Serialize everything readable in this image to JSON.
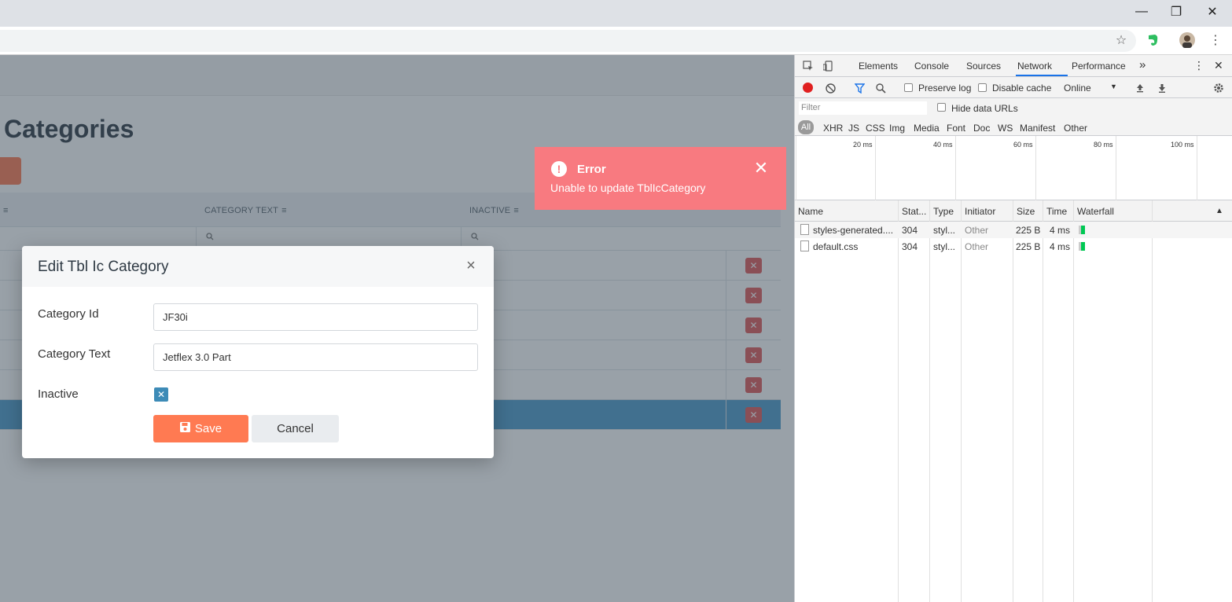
{
  "browser": {
    "window_controls": {
      "minimize": "—",
      "restore": "❐",
      "close": "✕"
    },
    "icons": {
      "bookmark": "☆",
      "evernote": "evernote-icon",
      "menu": "⋮"
    }
  },
  "app": {
    "page_title": "Categories",
    "columns": [
      {
        "label": "CATEGORY TEXT"
      },
      {
        "label": "INACTIVE"
      }
    ],
    "delete_glyph": "✕",
    "sort_glyph": "≡",
    "search_glyph": "🔍"
  },
  "modal": {
    "title": "Edit Tbl Ic Category",
    "close_glyph": "×",
    "fields": {
      "category_id_label": "Category Id",
      "category_id_value": "JF30i",
      "category_text_label": "Category Text",
      "category_text_value": "Jetflex 3.0 Part",
      "inactive_label": "Inactive",
      "inactive_glyph": "✕"
    },
    "save_label": "Save",
    "cancel_label": "Cancel"
  },
  "toast": {
    "title": "Error",
    "message": "Unable to update TblIcCategory",
    "icon_glyph": "!",
    "close_glyph": "✕",
    "color": "#f87a80"
  },
  "devtools": {
    "tabs": [
      "Elements",
      "Console",
      "Sources",
      "Network",
      "Performance"
    ],
    "more_tabs": "»",
    "active_tab": "Network",
    "toolbar": {
      "preserve_log": "Preserve log",
      "disable_cache": "Disable cache",
      "throttle": "Online",
      "throttle_caret": "▼"
    },
    "filter_placeholder": "Filter",
    "hide_data_urls": "Hide data URLs",
    "types": [
      "All",
      "XHR",
      "JS",
      "CSS",
      "Img",
      "Media",
      "Font",
      "Doc",
      "WS",
      "Manifest",
      "Other"
    ],
    "timeline_ticks": [
      "20 ms",
      "40 ms",
      "60 ms",
      "80 ms",
      "100 ms"
    ],
    "columns": [
      "Name",
      "Stat...",
      "Type",
      "Initiator",
      "Size",
      "Time",
      "Waterfall"
    ],
    "sort_caret": "▲",
    "requests": [
      {
        "name": "styles-generated....",
        "status": "304",
        "type": "styl...",
        "initiator": "Other",
        "size": "225 B",
        "time": "4 ms"
      },
      {
        "name": "default.css",
        "status": "304",
        "type": "styl...",
        "initiator": "Other",
        "size": "225 B",
        "time": "4 ms"
      }
    ]
  }
}
